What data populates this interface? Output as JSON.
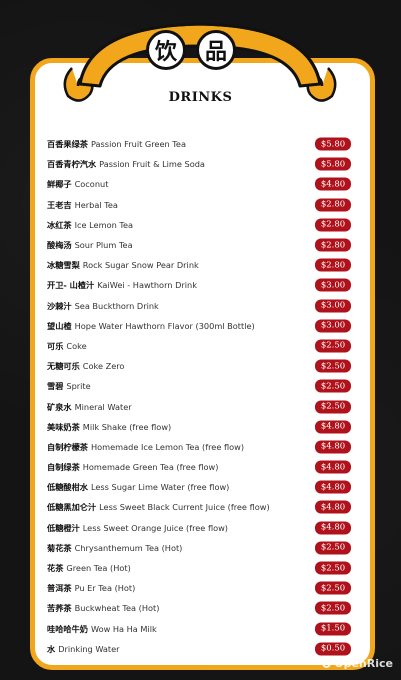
{
  "header": {
    "title_char_1": "饮",
    "title_char_2": "品",
    "section_title": "DRINKS"
  },
  "colors": {
    "accent": "#f2a61c",
    "price_badge": "#b0121b",
    "background": "#141414"
  },
  "items": [
    {
      "zh": "百香果绿茶",
      "en": "Passion Fruit Green Tea",
      "price": "$5.80"
    },
    {
      "zh": "百香青柠汽水",
      "en": "Passion Fruit & Lime Soda",
      "price": "$5.80"
    },
    {
      "zh": "鲜椰子",
      "en": "Coconut",
      "price": "$4.80"
    },
    {
      "zh": "王老吉",
      "en": "Herbal Tea",
      "price": "$2.80"
    },
    {
      "zh": "冰红茶",
      "en": "Ice Lemon Tea",
      "price": "$2.80"
    },
    {
      "zh": "酸梅汤",
      "en": "Sour Plum Tea",
      "price": "$2.80"
    },
    {
      "zh": "冰糖雪梨",
      "en": "Rock Sugar Snow Pear Drink",
      "price": "$2.80"
    },
    {
      "zh": "开卫- 山楂汁",
      "en": "KaiWei - Hawthorn Drink",
      "price": "$3.00"
    },
    {
      "zh": "沙棘汁",
      "en": "Sea Buckthorn Drink",
      "price": "$3.00"
    },
    {
      "zh": "望山楂",
      "en": "Hope Water Hawthorn Flavor (300ml Bottle)",
      "price": "$3.00"
    },
    {
      "zh": "可乐",
      "en": "Coke",
      "price": "$2.50"
    },
    {
      "zh": "无糖可乐",
      "en": "Coke Zero",
      "price": "$2.50"
    },
    {
      "zh": "雪碧",
      "en": "Sprite",
      "price": "$2.50"
    },
    {
      "zh": "矿泉水",
      "en": "Mineral Water",
      "price": "$2.50"
    },
    {
      "zh": "美味奶茶",
      "en": "Milk Shake (free flow)",
      "price": "$4.80"
    },
    {
      "zh": "自制柠檬茶",
      "en": "Homemade Ice Lemon Tea (free flow)",
      "price": "$4.80"
    },
    {
      "zh": "自制绿茶",
      "en": "Homemade Green Tea (free flow)",
      "price": "$4.80"
    },
    {
      "zh": "低糖酸柑水",
      "en": "Less Sugar Lime Water (free flow)",
      "price": "$4.80"
    },
    {
      "zh": "低糖黑加仑汁",
      "en": "Less Sweet Black Current Juice (free flow)",
      "price": "$4.80"
    },
    {
      "zh": "低糖橙汁",
      "en": "Less Sweet Orange Juice (free flow)",
      "price": "$4.80"
    },
    {
      "zh": "菊花茶",
      "en": "Chrysanthemum Tea (Hot)",
      "price": "$2.50"
    },
    {
      "zh": "花茶",
      "en": "Green Tea (Hot)",
      "price": "$2.50"
    },
    {
      "zh": "普洱茶",
      "en": "Pu Er Tea (Hot)",
      "price": "$2.50"
    },
    {
      "zh": "苦荞茶",
      "en": "Buckwheat Tea (Hot)",
      "price": "$2.50"
    },
    {
      "zh": "哇哈哈牛奶",
      "en": "Wow Ha Ha Milk",
      "price": "$1.50"
    },
    {
      "zh": "水",
      "en": "Drinking Water",
      "price": "$0.50"
    }
  ],
  "watermark": "OpenRice"
}
